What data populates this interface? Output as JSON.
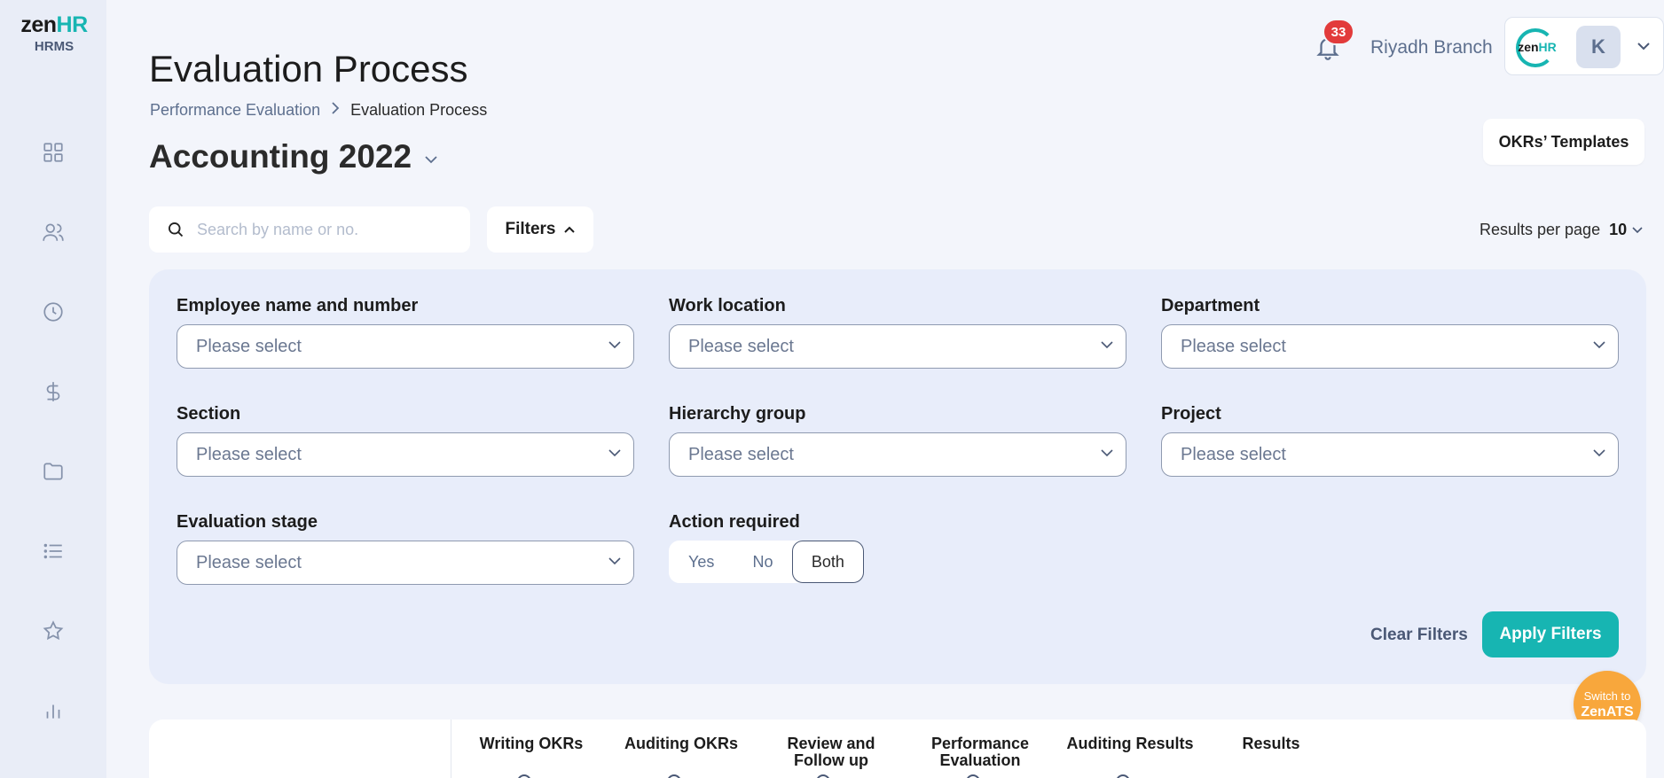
{
  "brand": {
    "logo_zen": "zen",
    "logo_hr": "HR",
    "product": "HRMS"
  },
  "sidebar": {
    "icons": [
      "dashboard-icon",
      "users-icon",
      "clock-icon",
      "dollar-icon",
      "folder-icon",
      "list-icon",
      "star-icon",
      "chart-icon"
    ]
  },
  "header": {
    "title": "Evaluation Process",
    "breadcrumb": {
      "parent": "Performance Evaluation",
      "current": "Evaluation Process"
    },
    "cycle": "Accounting 2022",
    "notifications_count": "33",
    "branch": "Riyadh Branch",
    "avatar_initial": "K",
    "okr_templates_label": "OKRs’ Templates"
  },
  "toolbar": {
    "search_placeholder": "Search by name or no.",
    "filters_label": "Filters",
    "results_per_page_label": "Results per page",
    "results_per_page_value": "10"
  },
  "filters": {
    "employee": {
      "label": "Employee name and number",
      "value": "Please select"
    },
    "work_location": {
      "label": "Work location",
      "value": "Please select"
    },
    "department": {
      "label": "Department",
      "value": "Please select"
    },
    "section": {
      "label": "Section",
      "value": "Please select"
    },
    "hierarchy_group": {
      "label": "Hierarchy group",
      "value": "Please select"
    },
    "project": {
      "label": "Project",
      "value": "Please select"
    },
    "evaluation_stage": {
      "label": "Evaluation stage",
      "value": "Please select"
    },
    "action_required": {
      "label": "Action required",
      "options": [
        "Yes",
        "No",
        "Both"
      ],
      "selected": "Both"
    },
    "clear_label": "Clear Filters",
    "apply_label": "Apply Filters"
  },
  "switch_app": {
    "top": "Switch to",
    "name": "ZenATS"
  },
  "table": {
    "stages": [
      {
        "line1": "Writing OKRs",
        "line2": ""
      },
      {
        "line1": "Auditing OKRs",
        "line2": ""
      },
      {
        "line1": "Review and",
        "line2": "Follow up"
      },
      {
        "line1": "Performance",
        "line2": "Evaluation"
      },
      {
        "line1": "Auditing Results",
        "line2": ""
      },
      {
        "line1": "Results",
        "line2": ""
      }
    ]
  },
  "colors": {
    "accent": "#17b5b2",
    "badge": "#e23b3b",
    "switch_bubble": "#f8a73c"
  }
}
